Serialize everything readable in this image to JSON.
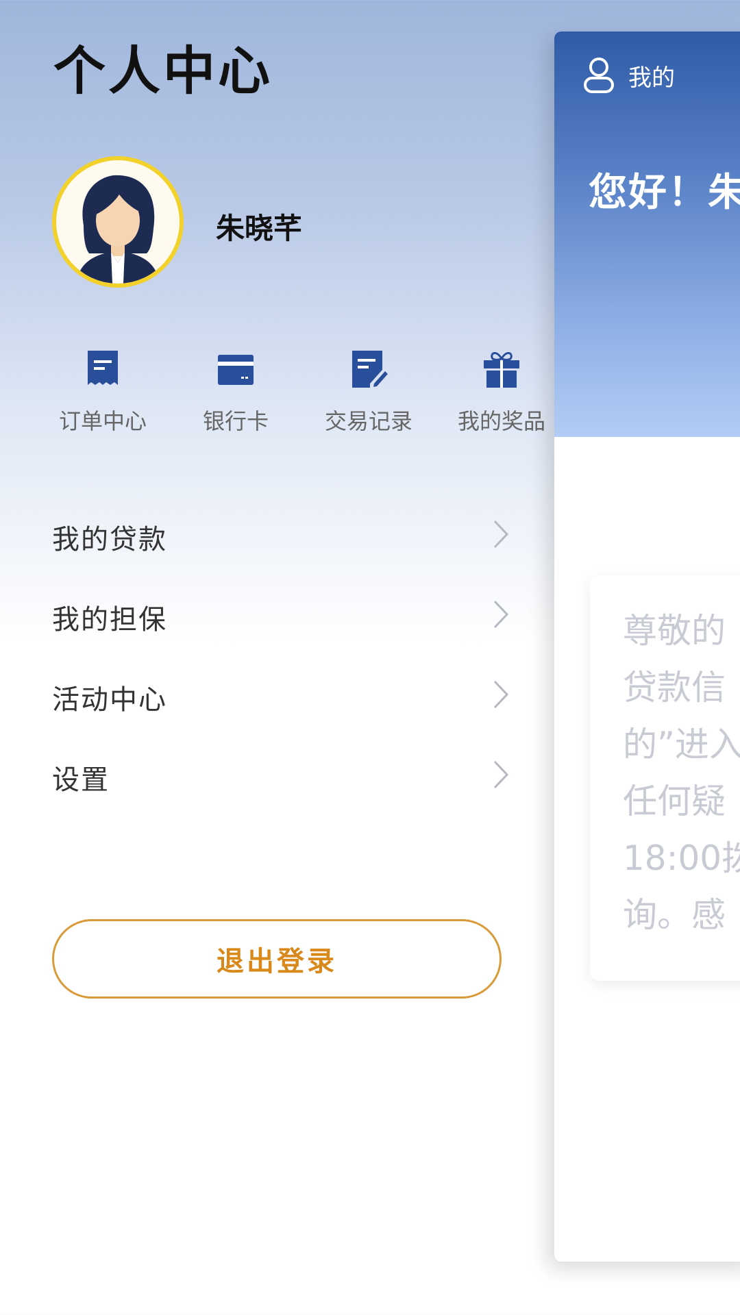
{
  "header": {
    "title": "个人中心"
  },
  "profile": {
    "name": "朱晓芊"
  },
  "quick_actions": [
    {
      "label": "订单中心",
      "icon": "receipt-icon"
    },
    {
      "label": "银行卡",
      "icon": "bank-card-icon"
    },
    {
      "label": "交易记录",
      "icon": "edit-document-icon"
    },
    {
      "label": "我的奖品",
      "icon": "gift-icon"
    }
  ],
  "menu": [
    {
      "label": "我的贷款"
    },
    {
      "label": "我的担保"
    },
    {
      "label": "活动中心"
    },
    {
      "label": "设置"
    }
  ],
  "logout": {
    "label": "退出登录"
  },
  "main": {
    "tab_label": "我的",
    "greeting": "您好！朱",
    "notice_lines": [
      "尊敬的",
      "贷款信",
      "的”进入",
      "任何疑",
      "18:00拨",
      "询。感"
    ]
  },
  "colors": {
    "accent_blue": "#2a4f9a",
    "logout_orange": "#d9891b",
    "avatar_ring": "#f2d12a"
  }
}
